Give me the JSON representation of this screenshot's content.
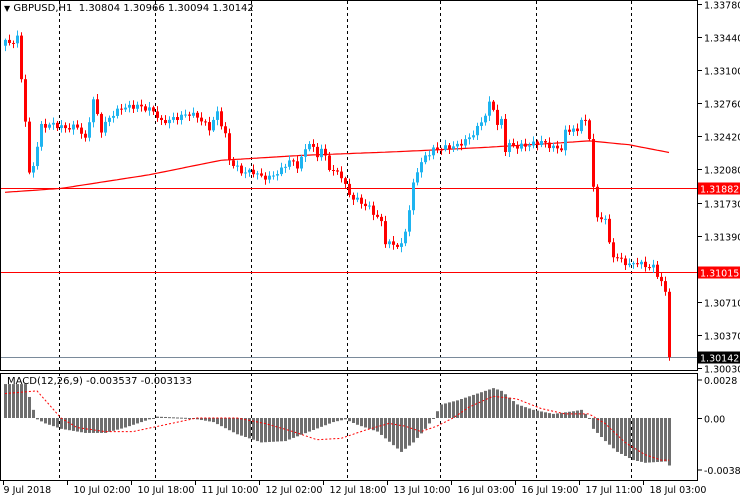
{
  "header": {
    "symbol_tf": "GBPUSD,H1",
    "open": "1.30804",
    "high": "1.30966",
    "low": "1.30094",
    "close": "1.30142"
  },
  "macd_header": {
    "label": "MACD(12,26,9)",
    "main": "-0.003537",
    "signal": "-0.003133"
  },
  "colors": {
    "bull": "#1EB4F0",
    "bear": "#FF0000",
    "ma": "#FF0000",
    "hist": "#6E6E6E",
    "signal": "#FF0000",
    "grid": "#000000"
  },
  "chart_data": [
    {
      "type": "candlestick",
      "title": "GBPUSD,H1",
      "bar_count": 167,
      "ylim": [
        1.3003,
        1.3378
      ],
      "y_ticks": [
        "1.33780",
        "1.33440",
        "1.33100",
        "1.32760",
        "1.32420",
        "1.32080",
        "1.31730",
        "1.31390",
        "1.30710",
        "1.30370",
        "1.30030"
      ],
      "x_ticks": [
        {
          "bar": 0,
          "label": "9 Jul 2018"
        },
        {
          "bar": 16,
          "label": "10 Jul 02:00"
        },
        {
          "bar": 32,
          "label": "10 Jul 18:00"
        },
        {
          "bar": 48,
          "label": "11 Jul 10:00"
        },
        {
          "bar": 64,
          "label": "12 Jul 02:00"
        },
        {
          "bar": 80,
          "label": "12 Jul 18:00"
        },
        {
          "bar": 96,
          "label": "13 Jul 10:00"
        },
        {
          "bar": 112,
          "label": "16 Jul 03:00"
        },
        {
          "bar": 128,
          "label": "16 Jul 19:00"
        },
        {
          "bar": 144,
          "label": "17 Jul 11:00"
        },
        {
          "bar": 160,
          "label": "18 Jul 03:00"
        }
      ],
      "day_separators_bar": [
        13.5,
        37.5,
        61.5,
        85.5,
        108.75,
        132.75,
        156.5
      ],
      "close_keypoints": [
        [
          0,
          1.3341
        ],
        [
          1,
          1.3336
        ],
        [
          3,
          1.3344
        ],
        [
          4,
          1.33
        ],
        [
          5,
          1.3259
        ],
        [
          6,
          1.3202
        ],
        [
          7,
          1.3212
        ],
        [
          9,
          1.3252
        ],
        [
          12,
          1.3254
        ],
        [
          15,
          1.325
        ],
        [
          18,
          1.3252
        ],
        [
          20,
          1.3238
        ],
        [
          22,
          1.3279
        ],
        [
          24,
          1.3248
        ],
        [
          26,
          1.3261
        ],
        [
          29,
          1.3271
        ],
        [
          33,
          1.3273
        ],
        [
          37,
          1.3268
        ],
        [
          39,
          1.3256
        ],
        [
          43,
          1.3261
        ],
        [
          46,
          1.3265
        ],
        [
          48,
          1.3262
        ],
        [
          51,
          1.325
        ],
        [
          53,
          1.3266
        ],
        [
          55,
          1.3243
        ],
        [
          56,
          1.3217
        ],
        [
          59,
          1.3205
        ],
        [
          62,
          1.3205
        ],
        [
          64,
          1.32
        ],
        [
          66,
          1.3199
        ],
        [
          69,
          1.3207
        ],
        [
          71,
          1.3217
        ],
        [
          73,
          1.3211
        ],
        [
          76,
          1.3236
        ],
        [
          78,
          1.3221
        ],
        [
          79,
          1.323
        ],
        [
          81,
          1.3209
        ],
        [
          84,
          1.3201
        ],
        [
          86,
          1.3181
        ],
        [
          88,
          1.3176
        ],
        [
          91,
          1.3168
        ],
        [
          94,
          1.3153
        ],
        [
          95,
          1.3133
        ],
        [
          97,
          1.313
        ],
        [
          99,
          1.3129
        ],
        [
          100,
          1.3145
        ],
        [
          101,
          1.3166
        ],
        [
          102,
          1.3192
        ],
        [
          103,
          1.3207
        ],
        [
          105,
          1.3221
        ],
        [
          107,
          1.3228
        ],
        [
          110,
          1.323
        ],
        [
          113,
          1.3232
        ],
        [
          116,
          1.324
        ],
        [
          118,
          1.325
        ],
        [
          120,
          1.3264
        ],
        [
          121,
          1.3275
        ],
        [
          122,
          1.3271
        ],
        [
          123,
          1.3253
        ],
        [
          124,
          1.3258
        ],
        [
          125,
          1.3228
        ],
        [
          126,
          1.3233
        ],
        [
          128,
          1.3231
        ],
        [
          131,
          1.3233
        ],
        [
          134,
          1.3236
        ],
        [
          137,
          1.323
        ],
        [
          139,
          1.3229
        ],
        [
          140,
          1.3246
        ],
        [
          142,
          1.325
        ],
        [
          143,
          1.3245
        ],
        [
          144,
          1.3261
        ],
        [
          145,
          1.3257
        ],
        [
          146,
          1.3238
        ],
        [
          147,
          1.3192
        ],
        [
          148,
          1.3156
        ],
        [
          150,
          1.3158
        ],
        [
          151,
          1.313
        ],
        [
          152,
          1.3119
        ],
        [
          154,
          1.3114
        ],
        [
          156,
          1.3109
        ],
        [
          158,
          1.3112
        ],
        [
          160,
          1.3108
        ],
        [
          162,
          1.3107
        ],
        [
          163,
          1.3099
        ],
        [
          164,
          1.3092
        ],
        [
          165,
          1.308
        ],
        [
          166,
          1.30142
        ]
      ],
      "moving_average_keypoints": [
        [
          0,
          1.3184
        ],
        [
          14,
          1.3188
        ],
        [
          36,
          1.3202
        ],
        [
          54,
          1.3217
        ],
        [
          74,
          1.3222
        ],
        [
          99,
          1.3226
        ],
        [
          119,
          1.323
        ],
        [
          139,
          1.3235
        ],
        [
          146,
          1.3237
        ],
        [
          156,
          1.3233
        ],
        [
          166,
          1.3225
        ]
      ],
      "horizontal_levels": [
        {
          "price": "1.31882",
          "style": "red-label"
        },
        {
          "price": "1.31015",
          "style": "red-label"
        },
        {
          "price": "1.30142",
          "style": "current-price"
        }
      ]
    },
    {
      "type": "bar",
      "title": "MACD(12,26,9)",
      "ylim": [
        -0.003838,
        0.0028
      ],
      "y_ticks": [
        "0.0028",
        "0.00",
        "-0.003838"
      ],
      "histogram_keypoints": [
        [
          0,
          0.0025
        ],
        [
          5,
          0.0025
        ],
        [
          7,
          0.0006
        ],
        [
          8,
          -0.0001
        ],
        [
          10,
          -0.0004
        ],
        [
          14,
          -0.0008
        ],
        [
          20,
          -0.0011
        ],
        [
          25,
          -0.0011
        ],
        [
          30,
          -0.0007
        ],
        [
          34,
          -0.0003
        ],
        [
          37,
          0
        ],
        [
          38,
          0.0001
        ],
        [
          46,
          0
        ],
        [
          52,
          -0.0003
        ],
        [
          58,
          -0.0012
        ],
        [
          64,
          -0.0018
        ],
        [
          70,
          -0.0017
        ],
        [
          76,
          -0.001
        ],
        [
          82,
          -0.0003
        ],
        [
          85,
          -0.0001
        ],
        [
          88,
          -0.0005
        ],
        [
          93,
          -0.001
        ],
        [
          97,
          -0.002
        ],
        [
          99,
          -0.0025
        ],
        [
          102,
          -0.0018
        ],
        [
          105,
          -0.0008
        ],
        [
          107,
          0
        ],
        [
          109,
          0.001
        ],
        [
          113,
          0.0013
        ],
        [
          120,
          0.002
        ],
        [
          122,
          0.0022
        ],
        [
          124,
          0.002
        ],
        [
          128,
          0.001
        ],
        [
          132,
          0.0006
        ],
        [
          137,
          0.0003
        ],
        [
          142,
          0.0005
        ],
        [
          144,
          0.0006
        ],
        [
          146,
          0
        ],
        [
          147,
          -0.0008
        ],
        [
          150,
          -0.0017
        ],
        [
          153,
          -0.0025
        ],
        [
          157,
          -0.0031
        ],
        [
          160,
          -0.0033
        ],
        [
          165,
          -0.0032
        ],
        [
          166,
          -0.0035
        ]
      ],
      "signal_keypoints": [
        [
          0,
          0.0018
        ],
        [
          8,
          0.002
        ],
        [
          14,
          0
        ],
        [
          18,
          -0.0007
        ],
        [
          25,
          -0.001
        ],
        [
          32,
          -0.001
        ],
        [
          40,
          -0.0005
        ],
        [
          48,
          0
        ],
        [
          58,
          0
        ],
        [
          65,
          -0.0004
        ],
        [
          72,
          -0.001
        ],
        [
          78,
          -0.0016
        ],
        [
          84,
          -0.0015
        ],
        [
          90,
          -0.0009
        ],
        [
          96,
          -0.0004
        ],
        [
          100,
          -0.0006
        ],
        [
          104,
          -0.001
        ],
        [
          108,
          -0.0006
        ],
        [
          112,
          0
        ],
        [
          116,
          0.0008
        ],
        [
          122,
          0.0016
        ],
        [
          128,
          0.0014
        ],
        [
          134,
          0.0007
        ],
        [
          140,
          0.0003
        ],
        [
          146,
          0.0003
        ],
        [
          150,
          -0.0004
        ],
        [
          155,
          -0.0018
        ],
        [
          160,
          -0.0027
        ],
        [
          164,
          -0.0031
        ],
        [
          166,
          -0.0031
        ]
      ]
    }
  ]
}
